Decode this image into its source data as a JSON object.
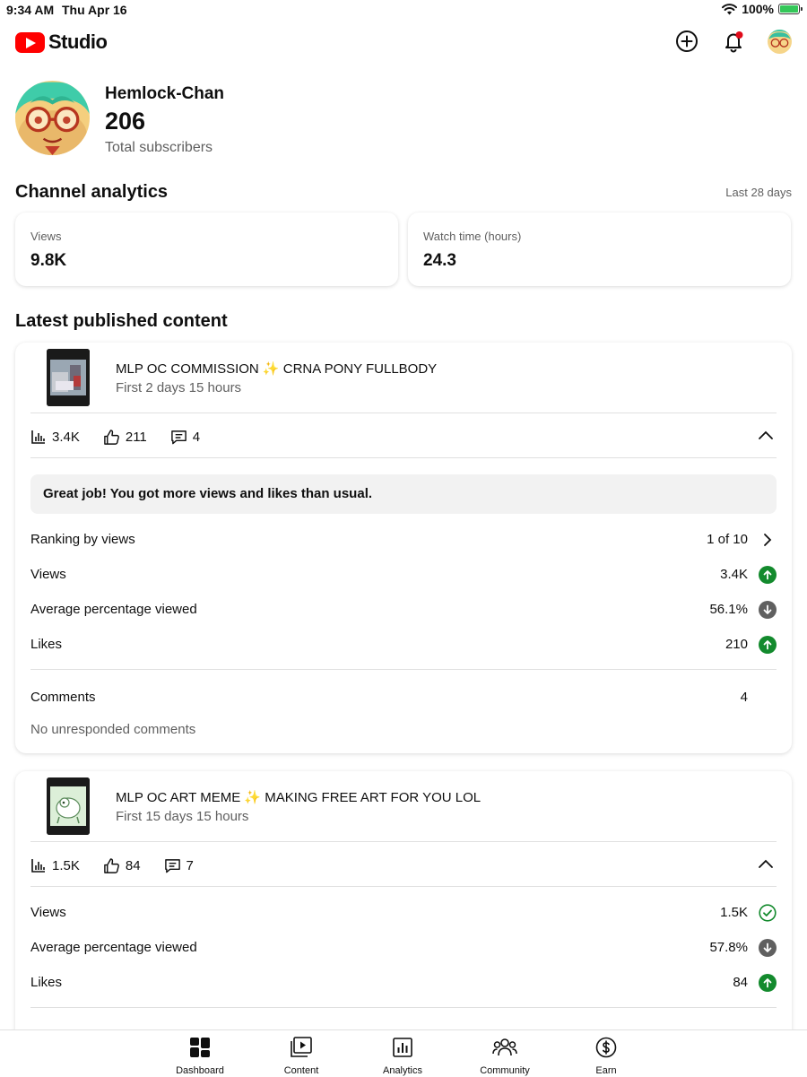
{
  "status_bar": {
    "time": "9:34 AM",
    "date": "Thu Apr 16",
    "battery": "100%"
  },
  "app": {
    "title": "Studio"
  },
  "channel": {
    "name": "Hemlock-Chan",
    "subscribers": "206",
    "subscribers_label": "Total subscribers"
  },
  "analytics": {
    "title": "Channel analytics",
    "period": "Last 28 days",
    "cards": [
      {
        "label": "Views",
        "value": "9.8K"
      },
      {
        "label": "Watch time (hours)",
        "value": "24.3"
      }
    ]
  },
  "latest": {
    "title": "Latest published content",
    "videos": [
      {
        "title": "MLP OC COMMISSION ✨ CRNA PONY FULLBODY",
        "subtitle": "First 2 days 15 hours",
        "views": "3.4K",
        "likes": "211",
        "comments": "4",
        "banner": "Great job! You got more views and likes than usual.",
        "ranking_label": "Ranking by views",
        "ranking_value": "1 of 10",
        "stats": [
          {
            "label": "Views",
            "value": "3.4K",
            "trend": "up"
          },
          {
            "label": "Average percentage viewed",
            "value": "56.1%",
            "trend": "down"
          },
          {
            "label": "Likes",
            "value": "210",
            "trend": "up"
          }
        ],
        "comments_label": "Comments",
        "comments_value": "4",
        "comments_note": "No unresponded comments"
      },
      {
        "title": "MLP OC ART MEME ✨ MAKING FREE ART FOR YOU LOL",
        "subtitle": "First 15 days 15 hours",
        "views": "1.5K",
        "likes": "84",
        "comments": "7",
        "stats": [
          {
            "label": "Views",
            "value": "1.5K",
            "trend": "check"
          },
          {
            "label": "Average percentage viewed",
            "value": "57.8%",
            "trend": "down"
          },
          {
            "label": "Likes",
            "value": "84",
            "trend": "up"
          }
        ]
      }
    ]
  },
  "bottom_nav": [
    {
      "label": "Dashboard"
    },
    {
      "label": "Content"
    },
    {
      "label": "Analytics"
    },
    {
      "label": "Community"
    },
    {
      "label": "Earn"
    }
  ],
  "colors": {
    "brand_red": "#ff0000",
    "trend_up": "#138a2d",
    "trend_down": "#606060",
    "muted_text": "#606060"
  }
}
